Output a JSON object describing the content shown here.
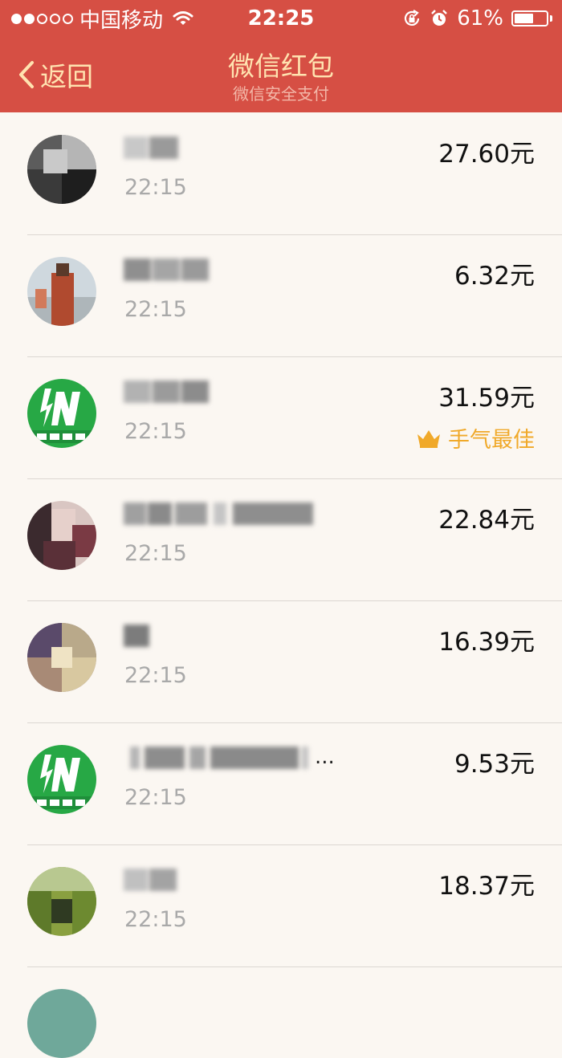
{
  "status_bar": {
    "carrier": "中国移动",
    "time": "22:25",
    "battery_text": "61%",
    "battery_level": 0.61,
    "signal_strength": 2,
    "signal_total": 5
  },
  "nav": {
    "back_label": "返回",
    "title": "微信红包",
    "subtitle": "微信安全支付"
  },
  "colors": {
    "header_bg": "#d64f44",
    "title_text": "#ffe3b0",
    "best_luck": "#f0a92a",
    "background": "#fbf7f2"
  },
  "recipients": [
    {
      "avatar": "avatar-photo",
      "name_hidden": true,
      "time": "22:15",
      "amount": "27.60元"
    },
    {
      "avatar": "avatar-photo",
      "name_hidden": true,
      "time": "22:15",
      "amount": "6.32元"
    },
    {
      "avatar": "avatar-logo-green",
      "name_hidden": true,
      "time": "22:15",
      "amount": "31.59元",
      "badge": "手气最佳",
      "badge_icon": "crown-icon"
    },
    {
      "avatar": "avatar-photo",
      "name_hidden": true,
      "time": "22:15",
      "amount": "22.84元"
    },
    {
      "avatar": "avatar-photo",
      "name_hidden": true,
      "time": "22:15",
      "amount": "16.39元"
    },
    {
      "avatar": "avatar-logo-green",
      "name_hidden": true,
      "name_suffix": "...",
      "time": "22:15",
      "amount": "9.53元"
    },
    {
      "avatar": "avatar-photo",
      "name_hidden": true,
      "time": "22:15",
      "amount": "18.37元"
    }
  ]
}
